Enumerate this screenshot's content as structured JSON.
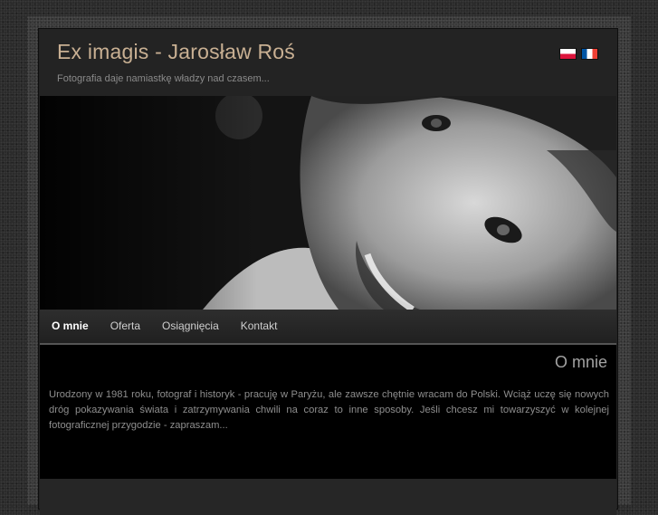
{
  "header": {
    "title": "Ex imagis - Jarosław Roś",
    "tagline": "Fotografia daje namiastkę władzy nad czasem..."
  },
  "languages": [
    {
      "code": "pl",
      "icon": "poland-flag-icon",
      "colors": [
        "#ffffff",
        "#dc143c"
      ]
    },
    {
      "code": "fr",
      "icon": "france-flag-icon",
      "colors": [
        "#0055a4",
        "#ffffff",
        "#ef4135"
      ]
    }
  ],
  "hero": {
    "description": "black-and-white portrait photograph"
  },
  "nav": {
    "items": [
      {
        "label": "O mnie",
        "active": true
      },
      {
        "label": "Oferta",
        "active": false
      },
      {
        "label": "Osiągnięcia",
        "active": false
      },
      {
        "label": "Kontakt",
        "active": false
      }
    ]
  },
  "content": {
    "heading": "O mnie",
    "text": "Urodzony w 1981 roku, fotograf i historyk - pracuję w Paryżu, ale zawsze chętnie wracam do Polski. Wciąż uczę się nowych dróg pokazywania świata i zatrzymywania chwili na coraz to inne sposoby. Jeśli chcesz mi towarzyszyć w kolejnej fotograficznej przygodzie - zapraszam..."
  },
  "colors": {
    "title": "#c9b093",
    "frame": "#232323",
    "content_bg": "#000000"
  }
}
